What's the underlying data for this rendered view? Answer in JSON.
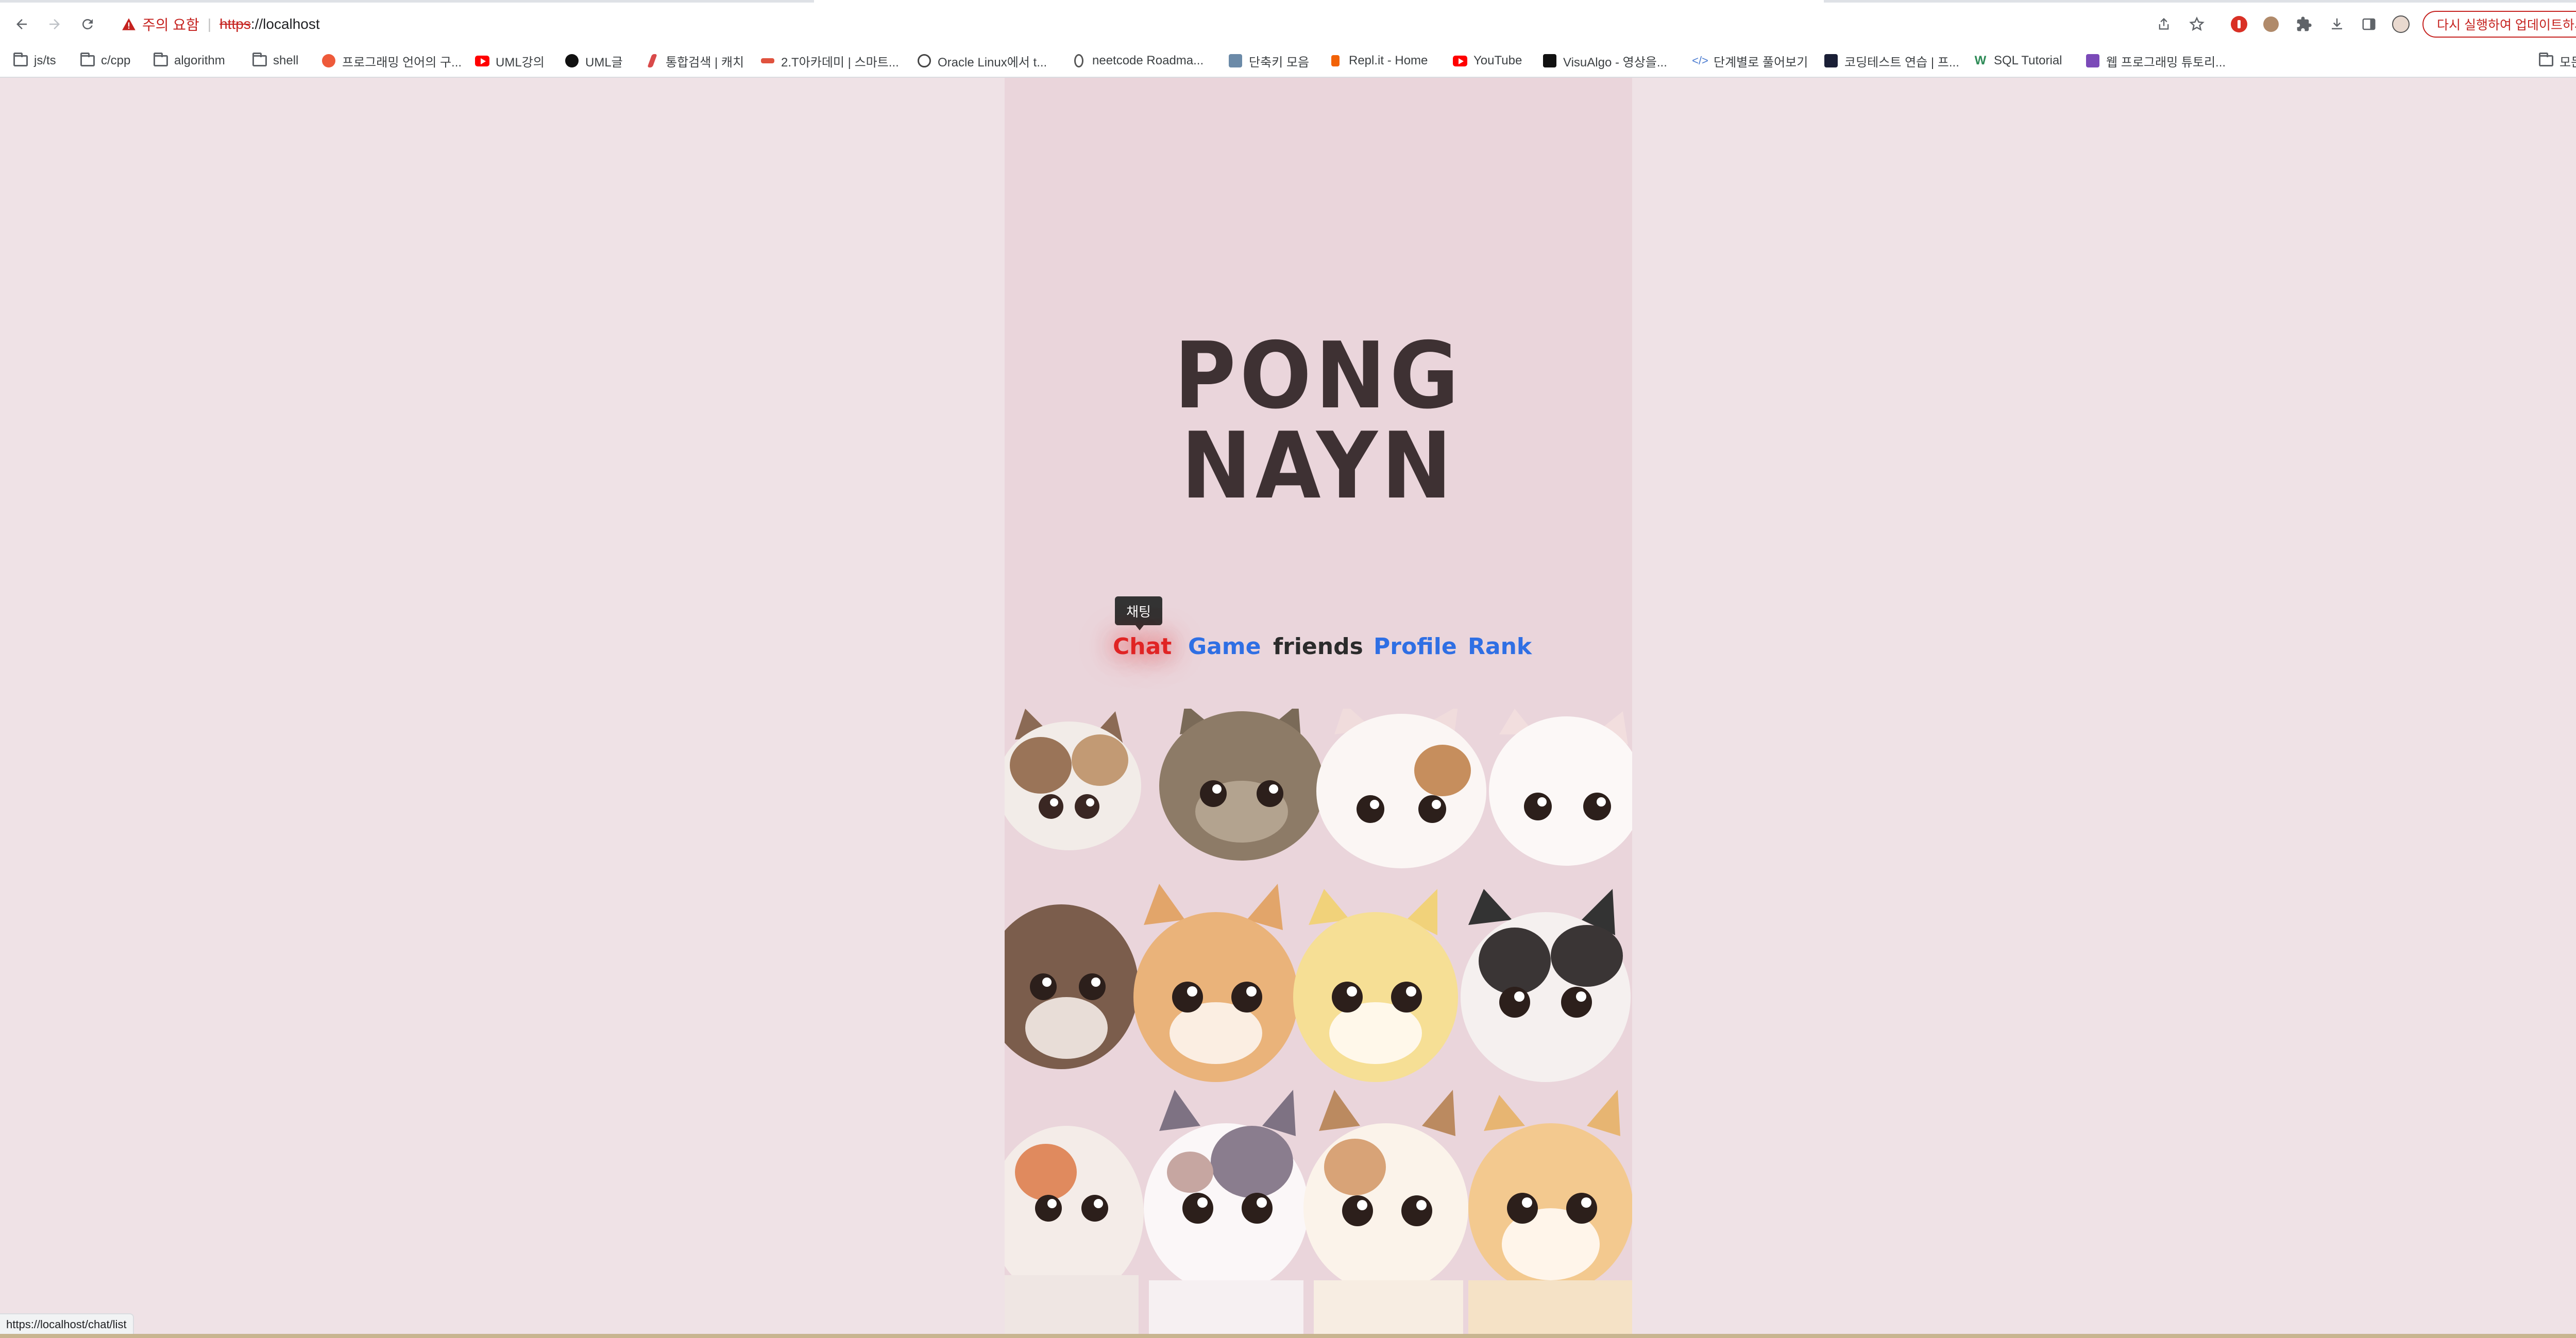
{
  "browser": {
    "security_warning": "주의 요함",
    "url_scheme": "https",
    "url_rest": "://localhost",
    "update_button": "다시 실행하여 업데이트하세요.",
    "update_menu": "⋮",
    "status_url": "https://localhost/chat/list"
  },
  "bookmarks": [
    {
      "label": "js/ts",
      "icon": "folder-icon"
    },
    {
      "label": "c/cpp",
      "icon": "folder-icon"
    },
    {
      "label": "algorithm",
      "icon": "folder-icon"
    },
    {
      "label": "shell",
      "icon": "folder-icon"
    },
    {
      "label": "프로그래밍 언어의 구...",
      "icon": "site-icon"
    },
    {
      "label": "UML강의",
      "icon": "youtube-icon"
    },
    {
      "label": "UML글",
      "icon": "site-icon"
    },
    {
      "label": "통합검색 | 캐치",
      "icon": "site-icon"
    },
    {
      "label": "2.T아카데미 | 스마트...",
      "icon": "site-icon"
    },
    {
      "label": "Oracle Linux에서 t...",
      "icon": "globe-icon"
    },
    {
      "label": "neetcode Roadma...",
      "icon": "site-icon"
    },
    {
      "label": "단축키 모음",
      "icon": "site-icon"
    },
    {
      "label": "Repl.it - Home",
      "icon": "site-icon"
    },
    {
      "label": "YouTube",
      "icon": "youtube-icon"
    },
    {
      "label": "VisuAlgo - 영상을...",
      "icon": "site-icon"
    },
    {
      "label": "단계별로 풀어보기",
      "icon": "site-icon"
    },
    {
      "label": "코딩테스트 연습 | 프...",
      "icon": "site-icon"
    },
    {
      "label": "SQL Tutorial",
      "icon": "site-icon"
    },
    {
      "label": "웹 프로그래밍 튜토리...",
      "icon": "site-icon"
    }
  ],
  "bookmarks_other": "모든 북마크",
  "page": {
    "logo_line1": "PONG",
    "logo_line2": "NAYN",
    "menu": {
      "chat": "Chat",
      "game": "Game",
      "friends": "friends",
      "profile": "Profile",
      "rank": "Rank"
    },
    "chat_tooltip": "채팅",
    "active_item": "Chat",
    "colors": {
      "page_bg": "#efe2e6",
      "panel_bg": "#ead5db",
      "logo": "#3e3133",
      "active": "#e02424",
      "link": "#2f6fe4",
      "visited": "#2b2b2b"
    },
    "illustration": "cats-group-illustration"
  }
}
